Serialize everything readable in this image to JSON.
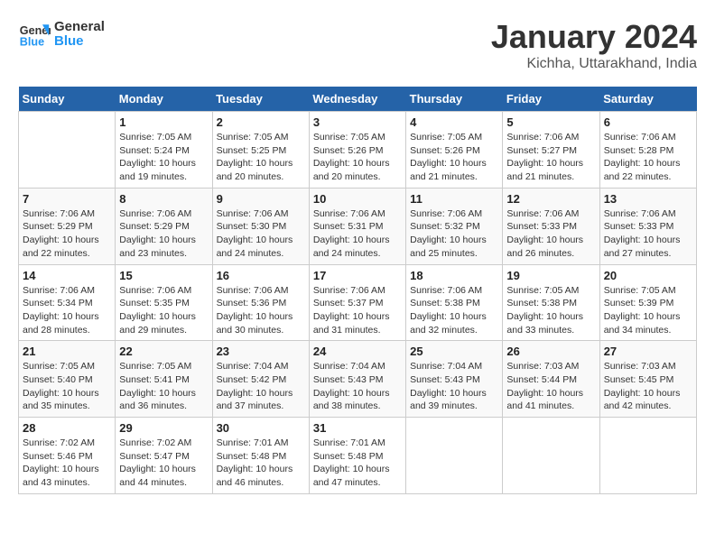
{
  "logo": {
    "line1": "General",
    "line2": "Blue"
  },
  "title": "January 2024",
  "location": "Kichha, Uttarakhand, India",
  "days_of_week": [
    "Sunday",
    "Monday",
    "Tuesday",
    "Wednesday",
    "Thursday",
    "Friday",
    "Saturday"
  ],
  "weeks": [
    [
      {
        "num": "",
        "sunrise": "",
        "sunset": "",
        "daylight": ""
      },
      {
        "num": "1",
        "sunrise": "Sunrise: 7:05 AM",
        "sunset": "Sunset: 5:24 PM",
        "daylight": "Daylight: 10 hours and 19 minutes."
      },
      {
        "num": "2",
        "sunrise": "Sunrise: 7:05 AM",
        "sunset": "Sunset: 5:25 PM",
        "daylight": "Daylight: 10 hours and 20 minutes."
      },
      {
        "num": "3",
        "sunrise": "Sunrise: 7:05 AM",
        "sunset": "Sunset: 5:26 PM",
        "daylight": "Daylight: 10 hours and 20 minutes."
      },
      {
        "num": "4",
        "sunrise": "Sunrise: 7:05 AM",
        "sunset": "Sunset: 5:26 PM",
        "daylight": "Daylight: 10 hours and 21 minutes."
      },
      {
        "num": "5",
        "sunrise": "Sunrise: 7:06 AM",
        "sunset": "Sunset: 5:27 PM",
        "daylight": "Daylight: 10 hours and 21 minutes."
      },
      {
        "num": "6",
        "sunrise": "Sunrise: 7:06 AM",
        "sunset": "Sunset: 5:28 PM",
        "daylight": "Daylight: 10 hours and 22 minutes."
      }
    ],
    [
      {
        "num": "7",
        "sunrise": "Sunrise: 7:06 AM",
        "sunset": "Sunset: 5:29 PM",
        "daylight": "Daylight: 10 hours and 22 minutes."
      },
      {
        "num": "8",
        "sunrise": "Sunrise: 7:06 AM",
        "sunset": "Sunset: 5:29 PM",
        "daylight": "Daylight: 10 hours and 23 minutes."
      },
      {
        "num": "9",
        "sunrise": "Sunrise: 7:06 AM",
        "sunset": "Sunset: 5:30 PM",
        "daylight": "Daylight: 10 hours and 24 minutes."
      },
      {
        "num": "10",
        "sunrise": "Sunrise: 7:06 AM",
        "sunset": "Sunset: 5:31 PM",
        "daylight": "Daylight: 10 hours and 24 minutes."
      },
      {
        "num": "11",
        "sunrise": "Sunrise: 7:06 AM",
        "sunset": "Sunset: 5:32 PM",
        "daylight": "Daylight: 10 hours and 25 minutes."
      },
      {
        "num": "12",
        "sunrise": "Sunrise: 7:06 AM",
        "sunset": "Sunset: 5:33 PM",
        "daylight": "Daylight: 10 hours and 26 minutes."
      },
      {
        "num": "13",
        "sunrise": "Sunrise: 7:06 AM",
        "sunset": "Sunset: 5:33 PM",
        "daylight": "Daylight: 10 hours and 27 minutes."
      }
    ],
    [
      {
        "num": "14",
        "sunrise": "Sunrise: 7:06 AM",
        "sunset": "Sunset: 5:34 PM",
        "daylight": "Daylight: 10 hours and 28 minutes."
      },
      {
        "num": "15",
        "sunrise": "Sunrise: 7:06 AM",
        "sunset": "Sunset: 5:35 PM",
        "daylight": "Daylight: 10 hours and 29 minutes."
      },
      {
        "num": "16",
        "sunrise": "Sunrise: 7:06 AM",
        "sunset": "Sunset: 5:36 PM",
        "daylight": "Daylight: 10 hours and 30 minutes."
      },
      {
        "num": "17",
        "sunrise": "Sunrise: 7:06 AM",
        "sunset": "Sunset: 5:37 PM",
        "daylight": "Daylight: 10 hours and 31 minutes."
      },
      {
        "num": "18",
        "sunrise": "Sunrise: 7:06 AM",
        "sunset": "Sunset: 5:38 PM",
        "daylight": "Daylight: 10 hours and 32 minutes."
      },
      {
        "num": "19",
        "sunrise": "Sunrise: 7:05 AM",
        "sunset": "Sunset: 5:38 PM",
        "daylight": "Daylight: 10 hours and 33 minutes."
      },
      {
        "num": "20",
        "sunrise": "Sunrise: 7:05 AM",
        "sunset": "Sunset: 5:39 PM",
        "daylight": "Daylight: 10 hours and 34 minutes."
      }
    ],
    [
      {
        "num": "21",
        "sunrise": "Sunrise: 7:05 AM",
        "sunset": "Sunset: 5:40 PM",
        "daylight": "Daylight: 10 hours and 35 minutes."
      },
      {
        "num": "22",
        "sunrise": "Sunrise: 7:05 AM",
        "sunset": "Sunset: 5:41 PM",
        "daylight": "Daylight: 10 hours and 36 minutes."
      },
      {
        "num": "23",
        "sunrise": "Sunrise: 7:04 AM",
        "sunset": "Sunset: 5:42 PM",
        "daylight": "Daylight: 10 hours and 37 minutes."
      },
      {
        "num": "24",
        "sunrise": "Sunrise: 7:04 AM",
        "sunset": "Sunset: 5:43 PM",
        "daylight": "Daylight: 10 hours and 38 minutes."
      },
      {
        "num": "25",
        "sunrise": "Sunrise: 7:04 AM",
        "sunset": "Sunset: 5:43 PM",
        "daylight": "Daylight: 10 hours and 39 minutes."
      },
      {
        "num": "26",
        "sunrise": "Sunrise: 7:03 AM",
        "sunset": "Sunset: 5:44 PM",
        "daylight": "Daylight: 10 hours and 41 minutes."
      },
      {
        "num": "27",
        "sunrise": "Sunrise: 7:03 AM",
        "sunset": "Sunset: 5:45 PM",
        "daylight": "Daylight: 10 hours and 42 minutes."
      }
    ],
    [
      {
        "num": "28",
        "sunrise": "Sunrise: 7:02 AM",
        "sunset": "Sunset: 5:46 PM",
        "daylight": "Daylight: 10 hours and 43 minutes."
      },
      {
        "num": "29",
        "sunrise": "Sunrise: 7:02 AM",
        "sunset": "Sunset: 5:47 PM",
        "daylight": "Daylight: 10 hours and 44 minutes."
      },
      {
        "num": "30",
        "sunrise": "Sunrise: 7:01 AM",
        "sunset": "Sunset: 5:48 PM",
        "daylight": "Daylight: 10 hours and 46 minutes."
      },
      {
        "num": "31",
        "sunrise": "Sunrise: 7:01 AM",
        "sunset": "Sunset: 5:48 PM",
        "daylight": "Daylight: 10 hours and 47 minutes."
      },
      {
        "num": "",
        "sunrise": "",
        "sunset": "",
        "daylight": ""
      },
      {
        "num": "",
        "sunrise": "",
        "sunset": "",
        "daylight": ""
      },
      {
        "num": "",
        "sunrise": "",
        "sunset": "",
        "daylight": ""
      }
    ]
  ]
}
